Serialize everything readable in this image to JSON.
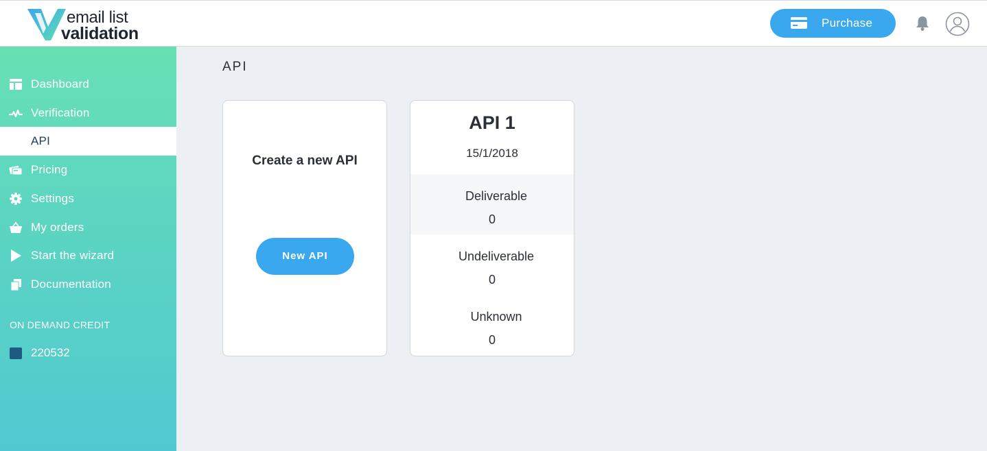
{
  "header": {
    "logo_line1": "email list",
    "logo_line2": "validation",
    "purchase_label": "Purchase",
    "icons": [
      "credit-card-icon",
      "bell-icon",
      "user-avatar-icon"
    ]
  },
  "sidebar": {
    "items": [
      {
        "label": "Dashboard",
        "icon": "dashboard-icon"
      },
      {
        "label": "Verification",
        "icon": "pulse-icon"
      },
      {
        "label": "API",
        "icon": null,
        "active": true
      },
      {
        "label": "Pricing",
        "icon": "pricing-icon"
      },
      {
        "label": "Settings",
        "icon": "gear-icon"
      },
      {
        "label": "My orders",
        "icon": "basket-icon"
      },
      {
        "label": "Start the wizard",
        "icon": "play-icon"
      },
      {
        "label": "Documentation",
        "icon": "documents-icon"
      }
    ],
    "credit_label": "ON DEMAND CREDIT",
    "credit_value": "220532"
  },
  "main": {
    "title": "API",
    "create_card": {
      "heading": "Create a new API",
      "button_label": "New API"
    },
    "api_card": {
      "name": "API 1",
      "date": "15/1/2018",
      "stats": [
        {
          "label": "Deliverable",
          "value": "0"
        },
        {
          "label": "Undeliverable",
          "value": "0"
        },
        {
          "label": "Unknown",
          "value": "0"
        }
      ]
    }
  },
  "colors": {
    "accent": "#3aa8ee",
    "sidebar_top": "#68e0b4",
    "sidebar_bottom": "#51c8d1",
    "active_text": "#1d3f66",
    "credit_square": "#1e5a82",
    "background": "#eceff3"
  }
}
